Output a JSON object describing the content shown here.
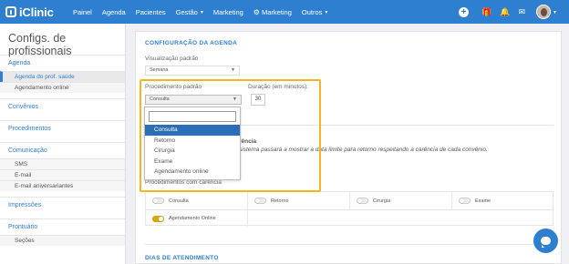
{
  "brand": {
    "name": "iClinic"
  },
  "nav": {
    "items": [
      {
        "label": "Painel"
      },
      {
        "label": "Agenda"
      },
      {
        "label": "Pacientes"
      },
      {
        "label": "Gestão",
        "has_caret": true
      },
      {
        "label": "Marketing"
      },
      {
        "label": "Marketing",
        "icon": "gear-icon"
      },
      {
        "label": "Outros",
        "has_caret": true
      }
    ],
    "caret": "▾",
    "gear": "⚙",
    "plus": "+",
    "gift": "🎁",
    "bell": "🔔",
    "message": "✉"
  },
  "sidebar": {
    "title": "Configs. de profissionais",
    "sections": [
      {
        "label": "Agenda",
        "items": [
          "Agenda do prof. saúde",
          "Agendamento online"
        ]
      },
      {
        "label": "Convênios",
        "items": []
      },
      {
        "label": "Procedimentos",
        "items": []
      },
      {
        "label": "Comunicação",
        "items": [
          "SMS",
          "E-mail",
          "E-mail aniversariantes"
        ]
      },
      {
        "label": "Impressões",
        "items": []
      },
      {
        "label": "Prontuário",
        "items": [
          "Seções"
        ]
      }
    ]
  },
  "main": {
    "section_title": "CONFIGURAÇÃO DA AGENDA",
    "view_label": "Visualização padrão",
    "view_value": "Semana",
    "procedure_label": "Procedimento padrão",
    "procedure_value": "Consulta",
    "duration_label": "Duração (em minutos):",
    "duration_value": "30",
    "carencia_title_fragment": "rência",
    "carencia_desc_fragment": "sistema passará a mostrar a data limite para retorno respeitando a carência de cada convênio.",
    "procedures_label": "Procedimentos com carência",
    "toggles": [
      {
        "label": "Consulta",
        "on": false
      },
      {
        "label": "Retorno",
        "on": false
      },
      {
        "label": "Cirurgia",
        "on": false
      },
      {
        "label": "Exame",
        "on": false
      },
      {
        "label": "Agendamento Online",
        "on": true
      }
    ],
    "next_section_title": "DIAS DE ATENDIMENTO"
  },
  "dropdown": {
    "search_value": "",
    "options": [
      "Consulta",
      "Retorno",
      "Cirurgia",
      "Exame",
      "Agendamento online"
    ],
    "selected": "Consulta"
  },
  "colors": {
    "primary": "#2f7fd0",
    "highlight": "#f2b622",
    "toggle_on": "#e0a800",
    "selected_option": "#2a6db8"
  }
}
